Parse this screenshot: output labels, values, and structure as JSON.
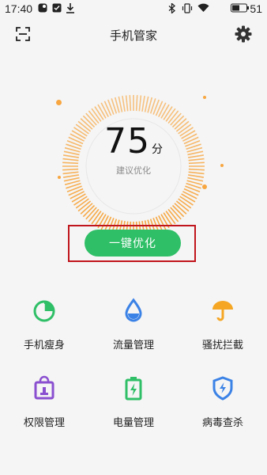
{
  "status_bar": {
    "time": "17:40",
    "battery": "51"
  },
  "header": {
    "title": "手机管家"
  },
  "score": {
    "value": "75",
    "unit": "分",
    "subtitle": "建议优化"
  },
  "optimize_button": {
    "label": "一键优化"
  },
  "tools": [
    {
      "label": "手机瘦身",
      "icon": "pie-chart-icon",
      "color": "#2fbf67"
    },
    {
      "label": "流量管理",
      "icon": "water-drop-icon",
      "color": "#3b82e6"
    },
    {
      "label": "骚扰拦截",
      "icon": "umbrella-icon",
      "color": "#f5a623"
    },
    {
      "label": "权限管理",
      "icon": "lock-bag-icon",
      "color": "#8a4fd0"
    },
    {
      "label": "电量管理",
      "icon": "battery-icon",
      "color": "#2fbf67"
    },
    {
      "label": "病毒查杀",
      "icon": "shield-icon",
      "color": "#3b82e6"
    }
  ],
  "colors": {
    "accent": "#2fbf67",
    "gauge": "#f7a640",
    "highlight": "#c0151c"
  }
}
